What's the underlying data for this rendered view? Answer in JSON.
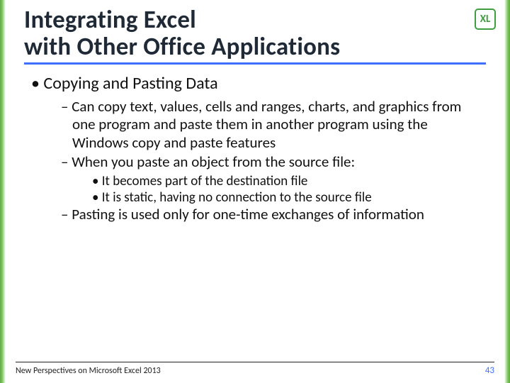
{
  "title_line1": "Integrating Excel",
  "title_line2": "with Other Office Applications",
  "badge": "XL",
  "bullets": {
    "lvl1": "Copying and Pasting Data",
    "lvl2_a": "Can copy text, values, cells and ranges, charts, and graphics from one program and paste them in another program using the Windows copy and paste features",
    "lvl2_b": "When you paste an object from the source file:",
    "lvl3_a": "It becomes part of the destination file",
    "lvl3_b": "It is static, having no connection to the source file",
    "lvl2_c": "Pasting is used only for one-time exchanges of information"
  },
  "footer": {
    "text": "New Perspectives on Microsoft Excel 2013",
    "page": "43"
  }
}
